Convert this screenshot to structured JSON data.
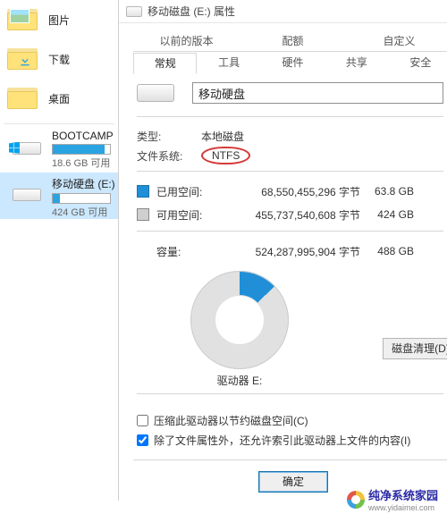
{
  "left": {
    "pictures": "图片",
    "downloads": "下载",
    "desktop": "桌面",
    "drives": [
      {
        "name": "BOOTCAMP (",
        "sub": "18.6 GB 可用",
        "fillPct": 91
      },
      {
        "name": "移动硬盘 (E:)",
        "sub": "424 GB 可用",
        "fillPct": 13
      }
    ]
  },
  "title": "移动磁盘 (E:) 属性",
  "tabs_row1": [
    "以前的版本",
    "配额",
    "自定义"
  ],
  "tabs_row2": [
    "常规",
    "工具",
    "硬件",
    "共享",
    "安全"
  ],
  "active_tab": "常规",
  "name_value": "移动硬盘",
  "type": {
    "k": "类型:",
    "v": "本地磁盘"
  },
  "fs": {
    "k": "文件系统:",
    "v": "NTFS"
  },
  "used": {
    "label": "已用空间:",
    "bytes": "68,550,455,296 字节",
    "human": "63.8 GB"
  },
  "free": {
    "label": "可用空间:",
    "bytes": "455,737,540,608 字节",
    "human": "424 GB"
  },
  "cap": {
    "label": "容量:",
    "bytes": "524,287,995,904 字节",
    "human": "488 GB"
  },
  "drive_label": "驱动器 E:",
  "cleanup_btn": "磁盘清理(D)",
  "chk_compress": "压缩此驱动器以节约磁盘空间(C)",
  "chk_index": "除了文件属性外，还允许索引此驱动器上文件的内容(I)",
  "ok": "确定",
  "watermark": {
    "brand": "纯净系统家园",
    "url": "www.yidaimei.com"
  },
  "chart_data": {
    "type": "pie",
    "title": "驱动器 E:",
    "series": [
      {
        "name": "已用空间",
        "value": 68550455296,
        "human": "63.8 GB"
      },
      {
        "name": "可用空间",
        "value": 455737540608,
        "human": "424 GB"
      }
    ],
    "total": {
      "value": 524287995904,
      "human": "488 GB"
    }
  }
}
